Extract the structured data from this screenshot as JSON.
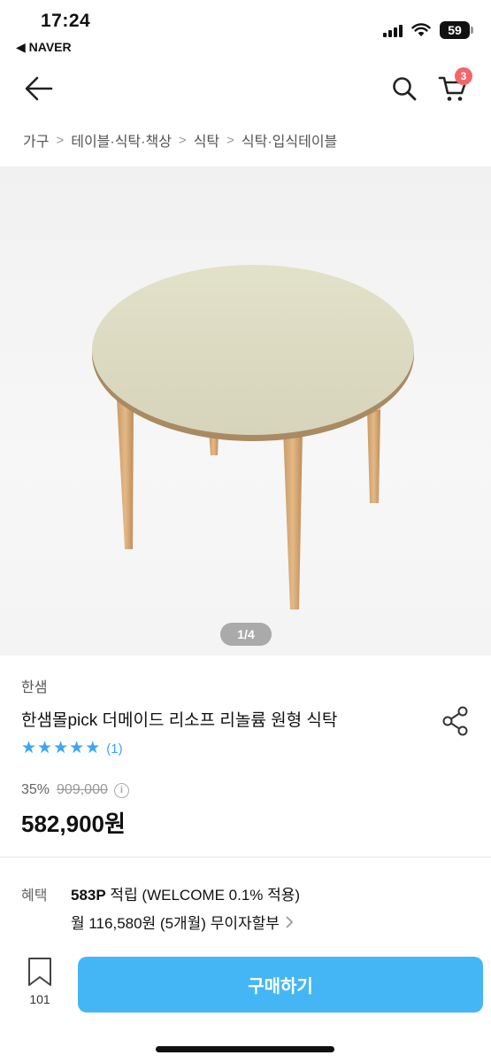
{
  "status_bar": {
    "time": "17:24",
    "back_app": "◀ NAVER",
    "battery": "59"
  },
  "header": {
    "back_icon": "arrow-left-icon",
    "search_icon": "search-icon",
    "cart_icon": "cart-icon",
    "cart_count": "3"
  },
  "breadcrumb": {
    "items": [
      "가구",
      "테이블·식탁·책상",
      "식탁",
      "식탁·입식테이블"
    ]
  },
  "gallery": {
    "counter": "1/4"
  },
  "product": {
    "brand": "한샘",
    "title": "한샘몰pick 더메이드 리소프 리놀륨 원형 식탁",
    "rating_stars": 5,
    "review_count": "(1)",
    "discount_rate": "35%",
    "original_price": "909,000",
    "sale_price": "582,900원"
  },
  "benefits": {
    "label": "혜택",
    "points_amount": "583P",
    "points_text": " 적립 (WELCOME 0.1% 적용)",
    "installment": "월 116,580원 (5개월) 무이자할부"
  },
  "bottom": {
    "bookmark_count": "101",
    "buy_label": "구매하기"
  },
  "colors": {
    "accent": "#45b6f5",
    "star": "#3ba7ef",
    "badge": "#f2666b"
  }
}
